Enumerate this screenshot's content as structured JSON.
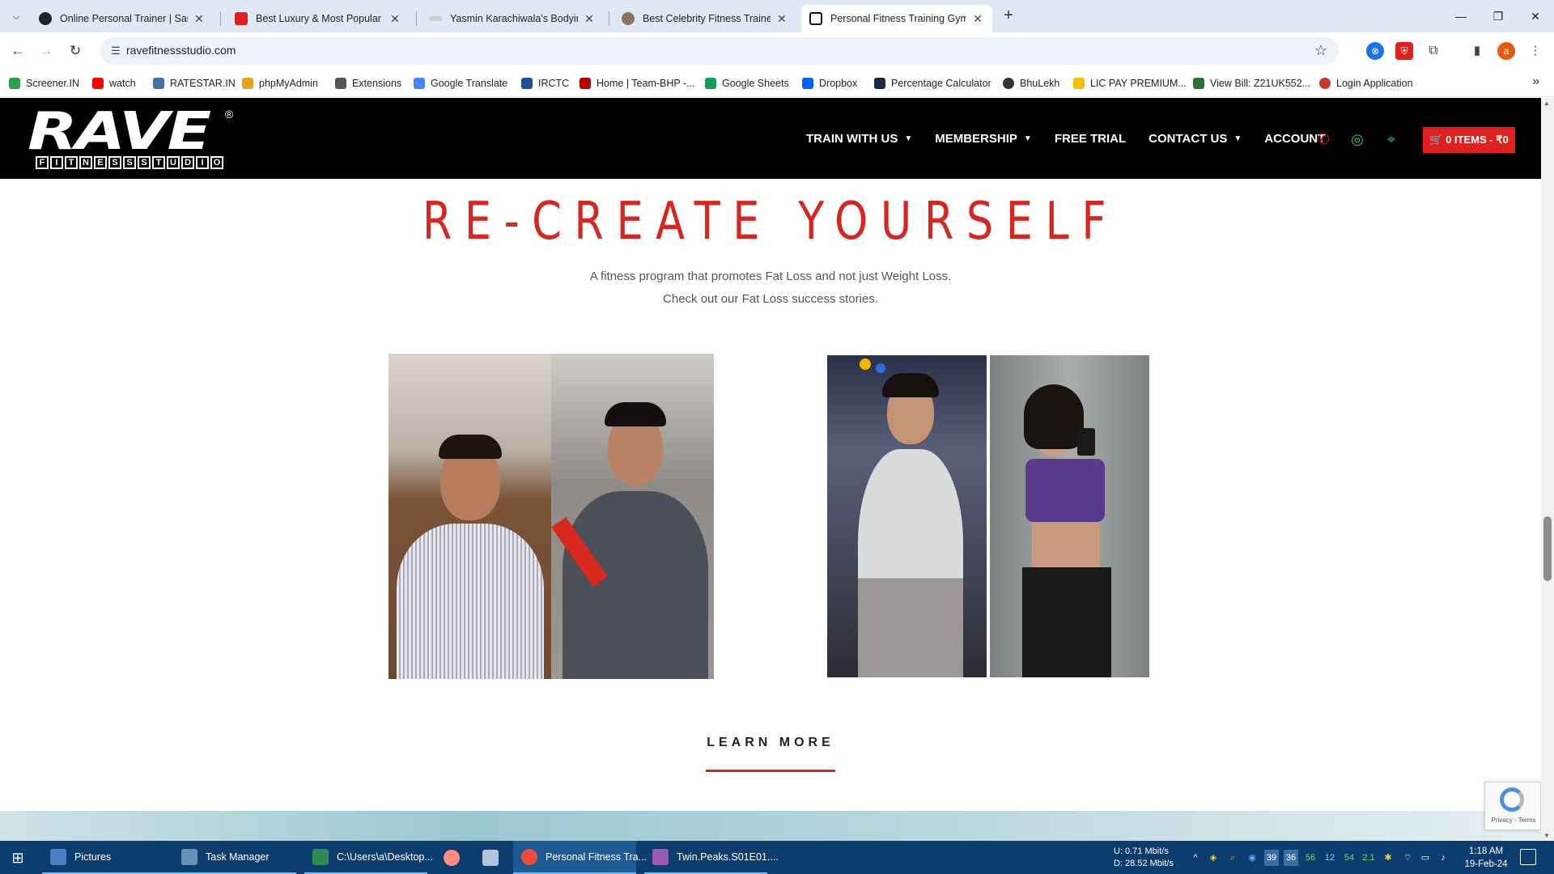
{
  "browser": {
    "tabs": [
      {
        "title": "Online Personal Trainer | Sarah",
        "favicon_color": "#222222",
        "active": false
      },
      {
        "title": "Best Luxury & Most Popular Gy",
        "favicon_color": "#e0201f",
        "active": false
      },
      {
        "title": "Yasmin Karachiwala's Bodyimag",
        "favicon_color": "#bbbbbb",
        "active": false
      },
      {
        "title": "Best Celebrity Fitness Trainer in",
        "favicon_color": "#8a7560",
        "active": false
      },
      {
        "title": "Personal Fitness Training Gym in",
        "favicon_color": "#111111",
        "active": true
      }
    ],
    "url": "ravefitnessstudio.com",
    "bookmarks": [
      {
        "label": "Screener.IN",
        "color": "#2e9e4d"
      },
      {
        "label": "watch",
        "color": "#ff0000"
      },
      {
        "label": "RATESTAR.IN",
        "color": "#4a6fa5"
      },
      {
        "label": "phpMyAdmin",
        "color": "#e3a21a"
      },
      {
        "label": "Extensions",
        "color": "#555555"
      },
      {
        "label": "Google Translate",
        "color": "#4285f4"
      },
      {
        "label": "IRCTC",
        "color": "#1f4e9e"
      },
      {
        "label": "Home | Team-BHP -...",
        "color": "#b40000"
      },
      {
        "label": "Google Sheets",
        "color": "#0f9d58"
      },
      {
        "label": "Dropbox",
        "color": "#0061fe"
      },
      {
        "label": "Percentage Calculator",
        "color": "#1a2a4a"
      },
      {
        "label": "BhuLekh",
        "color": "#333333"
      },
      {
        "label": "LIC PAY PREMIUM...",
        "color": "#f2c200"
      },
      {
        "label": "View Bill: Z21UK552...",
        "color": "#2f6f3e"
      },
      {
        "label": "Login Application",
        "color": "#c0392b"
      }
    ]
  },
  "site": {
    "logo_text": "RAVE",
    "logo_sub": [
      "F",
      "I",
      "T",
      "N",
      "E",
      "S",
      "S",
      "S",
      "T",
      "U",
      "D",
      "I",
      "O"
    ],
    "logo_reg": "®",
    "nav": [
      {
        "label": "TRAIN WITH US",
        "dropdown": true
      },
      {
        "label": "MEMBERSHIP",
        "dropdown": true
      },
      {
        "label": "FREE TRIAL",
        "dropdown": false
      },
      {
        "label": "CONTACT US",
        "dropdown": true
      },
      {
        "label": "ACCOUNT",
        "dropdown": false
      }
    ],
    "cart_label": "0 ITEMS - ₹0",
    "accent": "#e0201f",
    "hero_title": "RE-CREATE YOURSELF",
    "tagline_1": "A fitness program that promotes Fat Loss and not just Weight Loss.",
    "tagline_2": "Check out our Fat Loss success stories.",
    "learn_more": "LEARN MORE",
    "recaptcha_text": "Privacy - Terms"
  },
  "taskbar": {
    "items": [
      {
        "label": "Pictures",
        "color": "#4a7fc1",
        "state": "normal"
      },
      {
        "label": "Task Manager",
        "color": "#6a8fb5",
        "state": "normal"
      },
      {
        "label": "C:\\Users\\a\\Desktop...",
        "color": "#2e8b57",
        "state": "normal"
      },
      {
        "label": "",
        "color": "#ff8a80",
        "state": "normal"
      },
      {
        "label": "",
        "color": "#b0c4de",
        "state": "normal"
      },
      {
        "label": "Personal Fitness Tra...",
        "color": "#e74c3c",
        "state": "active"
      },
      {
        "label": "Twin.Peaks.S01E01....",
        "color": "#9b59b6",
        "state": "open"
      }
    ],
    "net_up": "U:      0.71 Mbit/s",
    "net_down": "D:    28.52 Mbit/s",
    "tray_numbers": [
      "39",
      "36",
      "56",
      "12",
      "54",
      "2.1"
    ],
    "time": "1:18 AM",
    "date": "19-Feb-24"
  }
}
